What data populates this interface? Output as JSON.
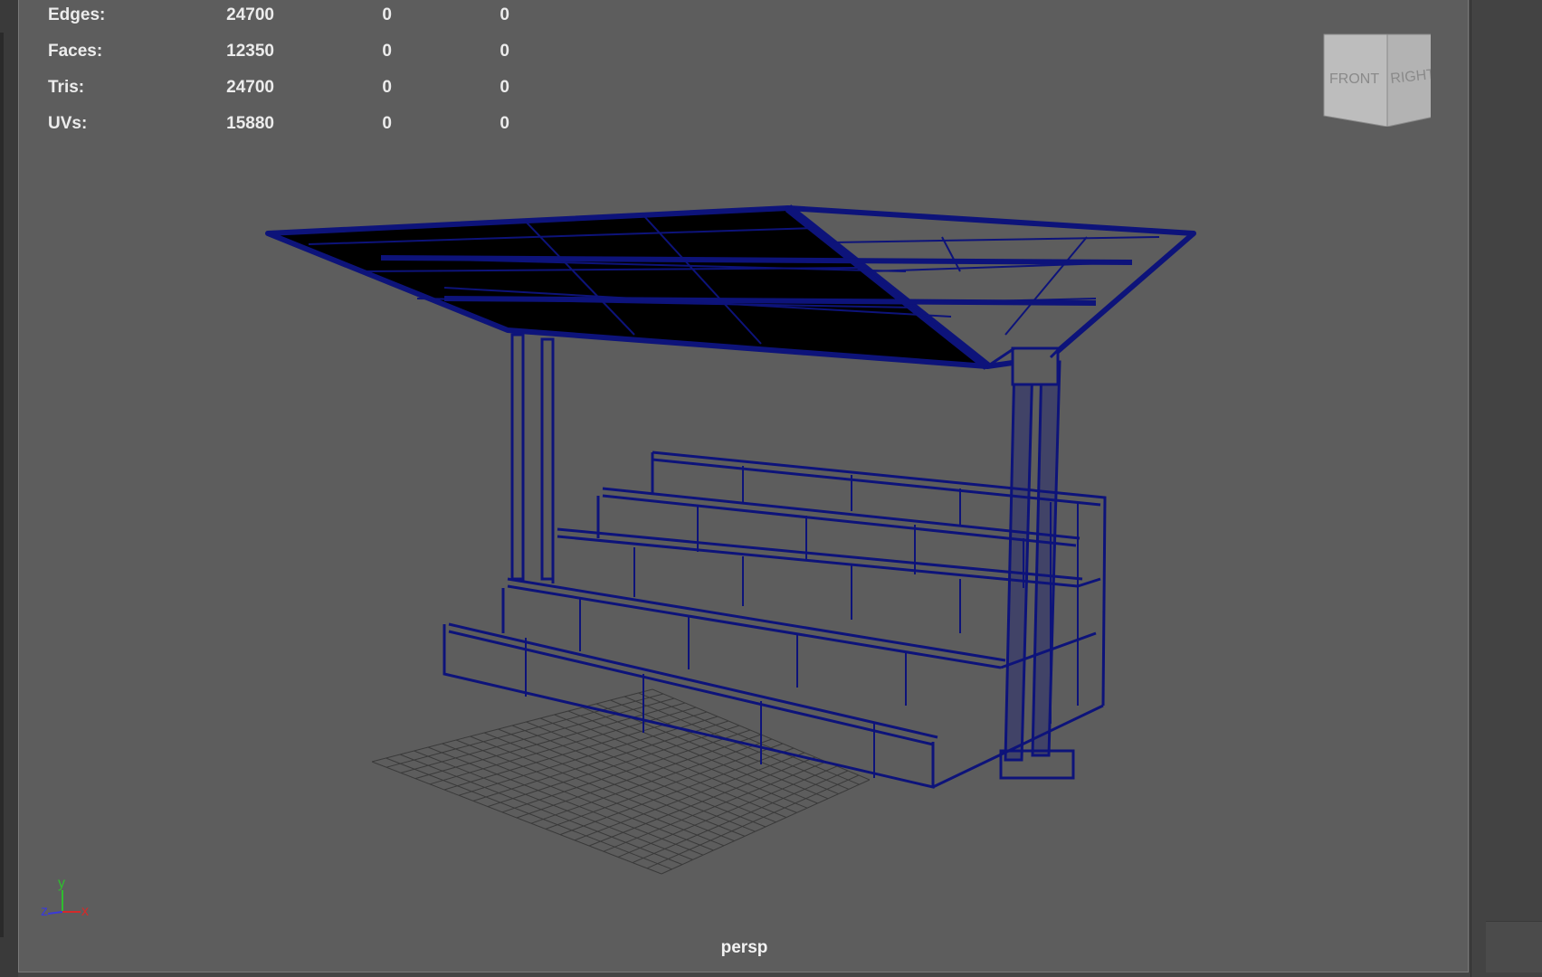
{
  "hud": {
    "rows": [
      {
        "label": "Edges:",
        "c1": "24700",
        "c2": "0",
        "c3": "0"
      },
      {
        "label": "Faces:",
        "c1": "12350",
        "c2": "0",
        "c3": "0"
      },
      {
        "label": "Tris:",
        "c1": "24700",
        "c2": "0",
        "c3": "0"
      },
      {
        "label": "UVs:",
        "c1": "15880",
        "c2": "0",
        "c3": "0"
      }
    ]
  },
  "viewcube": {
    "front": "FRONT",
    "right": "RIGHT"
  },
  "axis": {
    "x": "x",
    "y": "y",
    "z": "z"
  },
  "camera": {
    "name": "persp"
  },
  "colors": {
    "viewport_bg": "#5d5d5d",
    "wireframe": "#0d137a",
    "roof_fill": "#000000",
    "grid": "#3a3a3a",
    "axis_x": "#d42a2a",
    "axis_y": "#2fbd2f",
    "axis_z": "#3a3ad9"
  },
  "icons": {
    "viewcube": "viewcube-icon",
    "axis": "axis-gizmo-icon"
  }
}
